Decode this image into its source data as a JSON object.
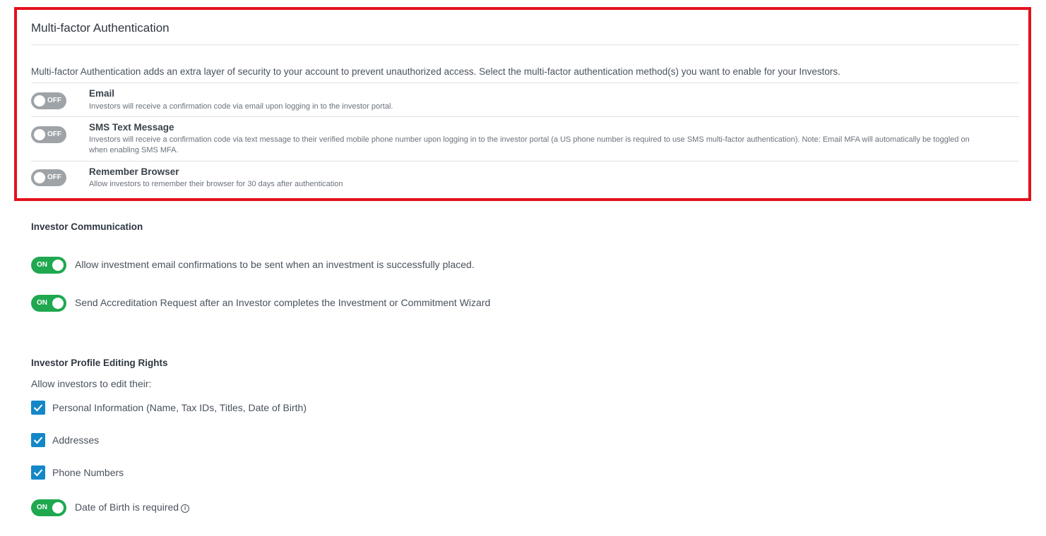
{
  "mfa": {
    "title": "Multi-factor Authentication",
    "description": "Multi-factor Authentication adds an extra layer of security to your account to prevent unauthorized access. Select the multi-factor authentication method(s) you want to enable for your Investors.",
    "options": [
      {
        "toggle": "OFF",
        "title": "Email",
        "description": "Investors will receive a confirmation code via email upon logging in to the investor portal."
      },
      {
        "toggle": "OFF",
        "title": "SMS Text Message",
        "description": "Investors will receive a confirmation code via text message to their verified mobile phone number upon logging in to the investor portal (a US phone number is required to use SMS multi-factor authentication). Note: Email MFA will automatically be toggled on when enabling SMS MFA."
      },
      {
        "toggle": "OFF",
        "title": "Remember Browser",
        "description": "Allow investors to remember their browser for 30 days after authentication"
      }
    ],
    "highlight_color": "#e3111c"
  },
  "communication": {
    "title": "Investor Communication",
    "items": [
      {
        "toggle": "ON",
        "label": "Allow investment email confirmations to be sent when an investment is successfully placed."
      },
      {
        "toggle": "ON",
        "label": "Send Accreditation Request after an Investor completes the Investment or Commitment Wizard"
      }
    ]
  },
  "profile_rights": {
    "title": "Investor Profile Editing Rights",
    "intro": "Allow investors to edit their:",
    "checkboxes": [
      {
        "label": "Personal Information (Name, Tax IDs, Titles, Date of Birth)",
        "checked": true
      },
      {
        "label": "Addresses",
        "checked": true
      },
      {
        "label": "Phone Numbers",
        "checked": true
      }
    ],
    "dob_toggle": {
      "toggle": "ON",
      "label": "Date of Birth is required",
      "icon": "info-icon"
    }
  },
  "colors": {
    "toggle_on": "#1fa84f",
    "toggle_off": "#9ea3a8",
    "checkbox": "#1487c9"
  }
}
